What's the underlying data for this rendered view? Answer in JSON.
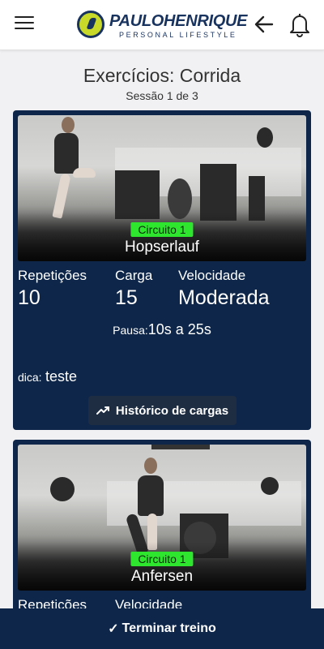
{
  "header": {
    "logo_name": "PAULOHENRIQUE",
    "logo_tagline": "PERSONAL LIFESTYLE"
  },
  "page": {
    "title": "Exercícios: Corrida",
    "subtitle": "Sessão 1 de 3"
  },
  "exercises": [
    {
      "circuit": "Circuito 1",
      "name": "Hopserlauf",
      "reps_label": "Repetições",
      "reps_value": "10",
      "load_label": "Carga",
      "load_value": "15",
      "speed_label": "Velocidade",
      "speed_value": "Moderada",
      "pause_label": "Pausa:",
      "pause_value": "10s a 25s",
      "tip_label": "dica:",
      "tip_value": "teste",
      "history_button": "Histórico de cargas"
    },
    {
      "circuit": "Circuito 1",
      "name": "Anfersen",
      "reps_label": "Repetições",
      "speed_label": "Velocidade"
    }
  ],
  "footer": {
    "finish_button": "Terminar treino",
    "finish_icon": "check-icon"
  },
  "colors": {
    "card_bg": "#0d2649",
    "badge_bg": "#2ee62e",
    "brand_lime": "#c8d92a",
    "brand_navy": "#19335f"
  }
}
